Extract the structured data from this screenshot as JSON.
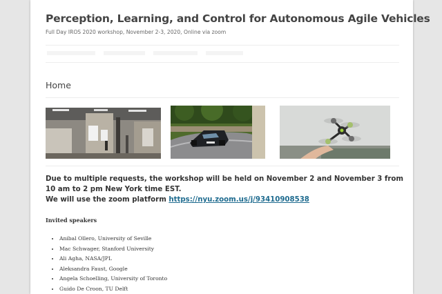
{
  "site": {
    "title": "Perception, Learning, and Control for Autonomous Agile Vehicles",
    "description": "Full Day IROS 2020 workshop, November 2-3, 2020, Online via zoom"
  },
  "page": {
    "heading": "Home"
  },
  "notice": {
    "line1": "Due to multiple requests, the workshop will be held on November 2 and November 3 from 10 am to 2 pm New York time EST.",
    "line2_prefix": "We will use the zoom platform",
    "zoom_link": "https://nyu.zoom.us/j/93410908538"
  },
  "speakers": {
    "heading": "Invited speakers",
    "items": [
      "Anibal Ollero, University of Seville",
      "Mac Schwager, Stanford University",
      "Ali Agha, NASA/JPL",
      "Aleksandra Faust, Google",
      "Angela Schoelling, University of Toronto",
      "Guido De Croon, TU Delft"
    ]
  },
  "colors": {
    "link": "#1e6b8f",
    "text": "#333333",
    "title": "#444444",
    "background": "#e6e6e6"
  }
}
